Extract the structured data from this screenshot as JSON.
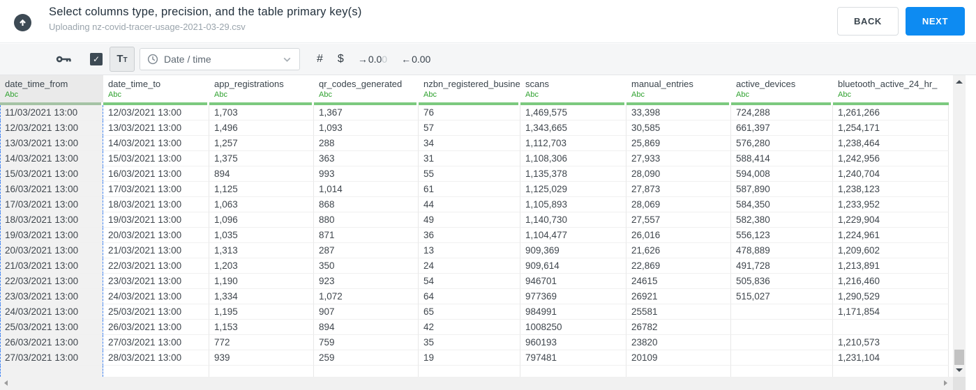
{
  "header": {
    "title": "Select columns type, precision, and the table primary key(s)",
    "subtitle": "Uploading nz-covid-tracer-usage-2021-03-29.csv",
    "upload_icon": "cloud-upload-icon",
    "back_label": "BACK",
    "next_label": "NEXT"
  },
  "toolbar": {
    "primary_key_icon": "key-icon",
    "checkbox_checked": true,
    "check_glyph": "✓",
    "text_type_big": "T",
    "text_type_small": "T",
    "type_dropdown": {
      "icon": "clock-icon",
      "value": "Date / time"
    },
    "number_type_label": "#",
    "currency_type_label": "$",
    "increase_decimal": {
      "arrow": "→",
      "digits_dark": "0.0",
      "digits_muted": "0"
    },
    "decrease_decimal": {
      "arrow": "←",
      "digits": "0.00"
    }
  },
  "table": {
    "selected_column_index": 0,
    "columns": [
      {
        "name": "date_time_from",
        "type": "Abc"
      },
      {
        "name": "date_time_to",
        "type": "Abc"
      },
      {
        "name": "app_registrations",
        "type": "Abc"
      },
      {
        "name": "qr_codes_generated",
        "type": "Abc"
      },
      {
        "name": "nzbn_registered_busine",
        "type": "Abc"
      },
      {
        "name": "scans",
        "type": "Abc"
      },
      {
        "name": "manual_entries",
        "type": "Abc"
      },
      {
        "name": "active_devices",
        "type": "Abc"
      },
      {
        "name": "bluetooth_active_24_hr_",
        "type": "Abc"
      }
    ],
    "rows": [
      [
        "11/03/2021 13:00",
        "12/03/2021 13:00",
        "1,703",
        "1,367",
        "76",
        "1,469,575",
        "33,398",
        "724,288",
        "1,261,266"
      ],
      [
        "12/03/2021 13:00",
        "13/03/2021 13:00",
        "1,496",
        "1,093",
        "57",
        "1,343,665",
        "30,585",
        "661,397",
        "1,254,171"
      ],
      [
        "13/03/2021 13:00",
        "14/03/2021 13:00",
        "1,257",
        "288",
        "34",
        "1,112,703",
        "25,869",
        "576,280",
        "1,238,464"
      ],
      [
        "14/03/2021 13:00",
        "15/03/2021 13:00",
        "1,375",
        "363",
        "31",
        "1,108,306",
        "27,933",
        "588,414",
        "1,242,956"
      ],
      [
        "15/03/2021 13:00",
        "16/03/2021 13:00",
        "894",
        "993",
        "55",
        "1,135,378",
        "28,090",
        "594,008",
        "1,240,704"
      ],
      [
        "16/03/2021 13:00",
        "17/03/2021 13:00",
        "1,125",
        "1,014",
        "61",
        "1,125,029",
        "27,873",
        "587,890",
        "1,238,123"
      ],
      [
        "17/03/2021 13:00",
        "18/03/2021 13:00",
        "1,063",
        "868",
        "44",
        "1,105,893",
        "28,069",
        "584,350",
        "1,233,952"
      ],
      [
        "18/03/2021 13:00",
        "19/03/2021 13:00",
        "1,096",
        "880",
        "49",
        "1,140,730",
        "27,557",
        "582,380",
        "1,229,904"
      ],
      [
        "19/03/2021 13:00",
        "20/03/2021 13:00",
        "1,035",
        "871",
        "36",
        "1,104,477",
        "26,016",
        "556,123",
        "1,224,961"
      ],
      [
        "20/03/2021 13:00",
        "21/03/2021 13:00",
        "1,313",
        "287",
        "13",
        "909,369",
        "21,626",
        "478,889",
        "1,209,602"
      ],
      [
        "21/03/2021 13:00",
        "22/03/2021 13:00",
        "1,203",
        "350",
        "24",
        "909,614",
        "22,869",
        "491,728",
        "1,213,891"
      ],
      [
        "22/03/2021 13:00",
        "23/03/2021 13:00",
        "1,190",
        "923",
        "54",
        "946701",
        "24615",
        "505,836",
        "1,216,460"
      ],
      [
        "23/03/2021 13:00",
        "24/03/2021 13:00",
        "1,334",
        "1,072",
        "64",
        "977369",
        "26921",
        "515,027",
        "1,290,529"
      ],
      [
        "24/03/2021 13:00",
        "25/03/2021 13:00",
        "1,195",
        "907",
        "65",
        "984991",
        "25581",
        "",
        "1,171,854"
      ],
      [
        "25/03/2021 13:00",
        "26/03/2021 13:00",
        "1,153",
        "894",
        "42",
        "1008250",
        "26782",
        "",
        ""
      ],
      [
        "26/03/2021 13:00",
        "27/03/2021 13:00",
        "772",
        "759",
        "35",
        "960193",
        "23820",
        "",
        "1,210,573"
      ],
      [
        "27/03/2021 13:00",
        "28/03/2021 13:00",
        "939",
        "259",
        "19",
        "797481",
        "20109",
        "",
        "1,231,104"
      ]
    ]
  },
  "colors": {
    "accent_green": "#7cc97f",
    "type_label_green": "#2fa12f",
    "selection_dash_blue": "#4285f4",
    "next_button_blue": "#0d8bf2",
    "icon_slate": "#3d4a54"
  }
}
